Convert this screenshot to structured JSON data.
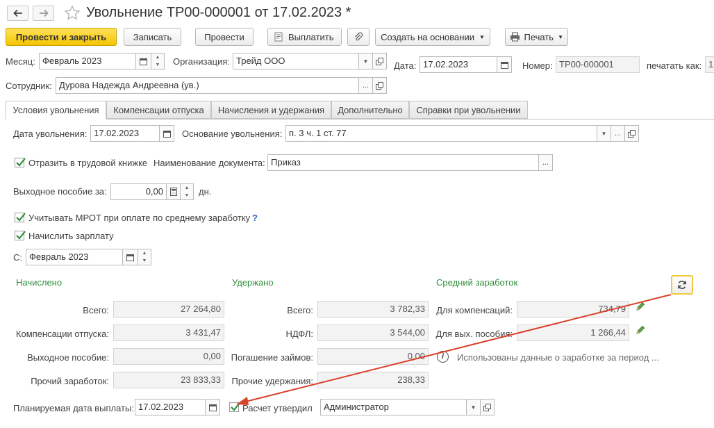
{
  "window": {
    "title": "Увольнение ТР00-000001 от 17.02.2023 *"
  },
  "toolbar": {
    "post_close": "Провести и закрыть",
    "save": "Записать",
    "post": "Провести",
    "pay": "Выплатить",
    "create_based": "Создать на основании",
    "print": "Печать"
  },
  "header": {
    "month_label": "Месяц:",
    "month_value": "Февраль 2023",
    "org_label": "Организация:",
    "org_value": "Трейд ООО",
    "date_label": "Дата:",
    "date_value": "17.02.2023",
    "number_label": "Номер:",
    "number_value": "ТР00-000001",
    "print_as_label": "печатать как:",
    "print_as_value": "1",
    "employee_label": "Сотрудник:",
    "employee_value": "Дурова Надежда Андреевна (ув.)"
  },
  "tabs": [
    {
      "label": "Условия увольнения"
    },
    {
      "label": "Компенсации отпуска"
    },
    {
      "label": "Начисления и удержания"
    },
    {
      "label": "Дополнительно"
    },
    {
      "label": "Справки при увольнении"
    }
  ],
  "conditions": {
    "dismissal_date_label": "Дата увольнения:",
    "dismissal_date_value": "17.02.2023",
    "basis_label": "Основание увольнения:",
    "basis_value": "п. 3 ч. 1 ст. 77",
    "workbook_label": "Отразить в трудовой книжке",
    "workbook_checked": true,
    "doc_name_label": "Наименование документа:",
    "doc_name_value": "Приказ",
    "severance_label": "Выходное пособие за:",
    "severance_value": "0,00",
    "severance_unit": "дн.",
    "mrot_label": "Учитывать МРОТ при оплате по среднему заработку",
    "mrot_checked": true,
    "mrot_help": "?",
    "accrue_label": "Начислить зарплату",
    "accrue_checked": true,
    "from_label": "С:",
    "from_value": "Февраль 2023"
  },
  "accrued": {
    "header": "Начислено",
    "rows": [
      {
        "label": "Всего:",
        "value": "27 264,80"
      },
      {
        "label": "Компенсации отпуска:",
        "value": "3 431,47"
      },
      {
        "label": "Выходное пособие:",
        "value": "0,00"
      },
      {
        "label": "Прочий заработок:",
        "value": "23 833,33"
      }
    ]
  },
  "withheld": {
    "header": "Удержано",
    "rows": [
      {
        "label": "Всего:",
        "value": "3 782,33"
      },
      {
        "label": "НДФЛ:",
        "value": "3 544,00"
      },
      {
        "label": "Погашение займов:",
        "value": "0,00"
      },
      {
        "label": "Прочие удержания:",
        "value": "238,33"
      }
    ]
  },
  "average": {
    "header": "Средний заработок",
    "rows": [
      {
        "label": "Для компенсаций:",
        "value": "734,79"
      },
      {
        "label": "Для вых. пособия:",
        "value": "1 266,44"
      }
    ],
    "info_text": "Использованы данные о заработке за период ..."
  },
  "footer": {
    "pay_date_label": "Планируемая дата выплаты:",
    "pay_date_value": "17.02.2023",
    "approved_label": "Расчет утвердил",
    "approved_checked": true,
    "approver_value": "Администратор"
  },
  "colors": {
    "accent_green": "#2f8f3a",
    "annotation_arrow": "#d9412b",
    "primary_button": "#f5c400"
  }
}
